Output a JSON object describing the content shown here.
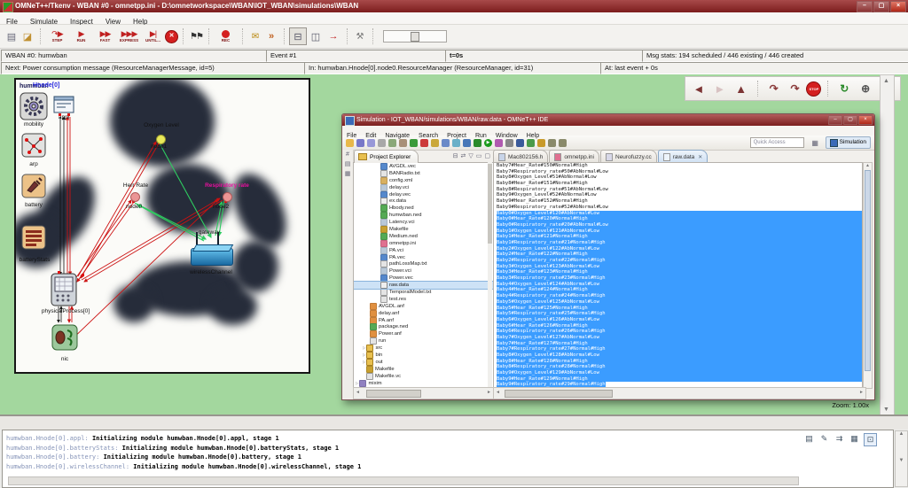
{
  "window": {
    "title": "OMNeT++/Tkenv - WBAN #0 - omnetpp.ini - D:\\omnetworkspace\\WBAN\\IOT_WBAN\\simulations\\WBAN",
    "menu": [
      "File",
      "Simulate",
      "Inspect",
      "View",
      "Help"
    ]
  },
  "toolbar": {
    "captions": {
      "step": "STEP",
      "run": "RUN",
      "fast": "FAST",
      "express": "EXPRESS",
      "until": "UNTIL...",
      "rec": "REC"
    },
    "icons": [
      "new-network",
      "load-config",
      "step",
      "run",
      "fast",
      "express",
      "until",
      "stop",
      "finish-flags",
      "record",
      "messages",
      "filter",
      "layout-horizontal",
      "layout-vertical",
      "timeline",
      "options-wrench",
      "speed-slider"
    ]
  },
  "status": {
    "network": "WBAN #0: humwban",
    "event": "Event #1",
    "sim_time": "t=0s",
    "msg_stats": "Msg stats: 194 scheduled / 446 existing / 446 created",
    "next_event": "Next: Power consumption message (ResourceManagerMessage, id=5)",
    "next_module": "In: humwban.Hnode[0].node0.ResourceManager (ResourceManager, id=31)",
    "next_time": "At: last event + 0s"
  },
  "canvas": {
    "network_label": "humwban",
    "node_label": "Hnode[0]",
    "zoom": "Zoom: 1.00x",
    "modules": {
      "appl": "appl",
      "mobility": "mobility",
      "arp": "arp",
      "battery": "battery",
      "battery_stats": "batteryStats",
      "physical_process": "physicalProcess[0]",
      "nic": "nic"
    },
    "sensors": {
      "oxygen": "Oxygen Level",
      "node1": "node1",
      "heart": "Herr Rate",
      "node0": "node0",
      "respiratory": "Respiratory rate",
      "node2": "node2",
      "gateway": "gateway",
      "wireless": "wirelessChannel"
    },
    "nav_icons": [
      "back",
      "forward",
      "up",
      "redo",
      "redo-until",
      "stop",
      "refresh",
      "zoom-in",
      "zoom-out"
    ]
  },
  "log": {
    "icons": [
      "copy",
      "pen",
      "filter",
      "fields",
      "monitor"
    ],
    "lines": [
      {
        "prefix": "humwban.Hnode[0].appl:",
        "text": "Initializing module humwban.Hnode[0].appl, stage 1"
      },
      {
        "prefix": "humwban.Hnode[0].batteryStats:",
        "text": "Initializing module humwban.Hnode[0].batteryStats, stage 1"
      },
      {
        "prefix": "humwban.Hnode[0].battery:",
        "text": "Initializing module humwban.Hnode[0].battery, stage 1"
      },
      {
        "prefix": "humwban.Hnode[0].wirelessChannel:",
        "text": "Initializing module humwban.Hnode[0].wirelessChannel, stage 1"
      }
    ]
  },
  "eclipse": {
    "title": "Simulation - IOT_WBAN/simulations/WBAN/raw.data - OMNeT++ IDE",
    "menu": [
      "File",
      "Edit",
      "Navigate",
      "Search",
      "Project",
      "Run",
      "Window",
      "Help"
    ],
    "quick_access": "Quick Access",
    "perspective": "Simulation",
    "toolbar_icons": [
      "new",
      "save",
      "save-all",
      "print",
      "import",
      "export",
      "run-last",
      "stop",
      "suspend",
      "step-into",
      "step-over",
      "search",
      "debug",
      "run",
      "profile",
      "external-tools",
      "open-type",
      "new-class",
      "sync",
      "nav-back",
      "nav-forward"
    ],
    "explorer": {
      "title": "Project Explorer",
      "items": [
        {
          "label": "AVGDL.vec",
          "icon": "vec",
          "indent": 30
        },
        {
          "label": "BANRadio.txt",
          "icon": "txt",
          "indent": 30
        },
        {
          "label": "config.xml",
          "icon": "xml",
          "indent": 30
        },
        {
          "label": "delay.vci",
          "icon": "vci",
          "indent": 30
        },
        {
          "label": "delay.vec",
          "icon": "vec",
          "indent": 30
        },
        {
          "label": "ex.data",
          "icon": "dat",
          "indent": 30
        },
        {
          "label": "Hbody.ned",
          "icon": "ned",
          "indent": 30
        },
        {
          "label": "humwban.ned",
          "icon": "ned",
          "indent": 30
        },
        {
          "label": "Latency.vci",
          "icon": "vci",
          "indent": 30
        },
        {
          "label": "Makefile",
          "icon": "mk",
          "indent": 30
        },
        {
          "label": "Medium.ned",
          "icon": "ned",
          "indent": 30
        },
        {
          "label": "omnetpp.ini",
          "icon": "ini",
          "indent": 30
        },
        {
          "label": "PA.vci",
          "icon": "vci",
          "indent": 30
        },
        {
          "label": "PA.vec",
          "icon": "vec",
          "indent": 30
        },
        {
          "label": "pathLossMap.txt",
          "icon": "txt",
          "indent": 30
        },
        {
          "label": "Power.vci",
          "icon": "vci",
          "indent": 30
        },
        {
          "label": "Power.vec",
          "icon": "vec",
          "indent": 30
        },
        {
          "label": "raw.data",
          "icon": "dat",
          "indent": 30,
          "selected": true
        },
        {
          "label": "TemporalModel.txt",
          "icon": "txt",
          "indent": 30
        },
        {
          "label": "test.res",
          "icon": "txt",
          "indent": 30
        },
        {
          "label": "AVGDL.anf",
          "icon": "anf",
          "indent": 18
        },
        {
          "label": "delay.anf",
          "icon": "anf",
          "indent": 18
        },
        {
          "label": "PA.anf",
          "icon": "anf",
          "indent": 18
        },
        {
          "label": "package.ned",
          "icon": "ned",
          "indent": 18
        },
        {
          "label": "Power.anf",
          "icon": "anf",
          "indent": 18
        },
        {
          "label": "run",
          "icon": "txt",
          "indent": 18
        },
        {
          "label": "src",
          "icon": "folder",
          "indent": 10,
          "arrow": true
        },
        {
          "label": "bin",
          "icon": "folder",
          "indent": 10,
          "arrow": true
        },
        {
          "label": "out",
          "icon": "folder",
          "indent": 10,
          "arrow": true
        },
        {
          "label": "Makefile",
          "icon": "mk",
          "indent": 14
        },
        {
          "label": "Makefile.vc",
          "icon": "txt",
          "indent": 14
        },
        {
          "label": "mixim",
          "icon": "proj",
          "indent": 2,
          "arrow": true
        }
      ]
    },
    "tabs": [
      {
        "label": "Mac802156.h",
        "icon": "h"
      },
      {
        "label": "omnetpp.ini",
        "icon": "ini"
      },
      {
        "label": "Neurofuzzy.cc",
        "icon": "cc"
      },
      {
        "label": "raw.data",
        "icon": "data",
        "active": true
      }
    ],
    "editor": {
      "selection_start": 8,
      "lines": [
        "Baby7#Hear_Rate#150#Normal#High",
        "Baby7#Respiratory_rate#50#AbNormal#Low",
        "Baby8#Oxygen_Level#51#AbNormal#Low",
        "Baby8#Hear_Rate#151#Normal#High",
        "Baby8#Respiratory_rate#51#AbNormal#Low",
        "Baby9#Oxygen_Level#52#AbNormal#Low",
        "Baby9#Hear_Rate#152#Normal#High",
        "Baby9#Respiratory_rate#52#AbNormal#Low",
        "Baby0#Oxygen_Level#120#AbNormal#Low",
        "Baby0#Hear_Rate#120#Normal#High",
        "Baby0#Respiratory_rate#20#AbNormal#Low",
        "Baby1#Oxygen_Level#121#AbNormal#Low",
        "Baby1#Hear_Rate#121#Normal#High",
        "Baby1#Respiratory_rate#21#Normal#High",
        "Baby2#Oxygen_Level#122#AbNormal#Low",
        "Baby2#Hear_Rate#122#Normal#High",
        "Baby2#Respiratory_rate#22#Normal#High",
        "Baby3#Oxygen_Level#123#AbNormal#Low",
        "Baby3#Hear_Rate#123#Normal#High",
        "Baby3#Respiratory_rate#23#Normal#High",
        "Baby4#Oxygen_Level#124#AbNormal#Low",
        "Baby4#Hear_Rate#124#Normal#High",
        "Baby4#Respiratory_rate#24#Normal#High",
        "Baby5#Oxygen_Level#125#AbNormal#Low",
        "Baby5#Hear_Rate#125#Normal#High",
        "Baby5#Respiratory_rate#25#Normal#High",
        "Baby6#Oxygen_Level#126#AbNormal#Low",
        "Baby6#Hear_Rate#126#Normal#High",
        "Baby6#Respiratory_rate#26#Normal#High",
        "Baby7#Oxygen_Level#127#AbNormal#Low",
        "Baby7#Hear_Rate#127#Normal#High",
        "Baby7#Respiratory_rate#27#Normal#High",
        "Baby8#Oxygen_Level#128#AbNormal#Low",
        "Baby8#Hear_Rate#128#Normal#High",
        "Baby8#Respiratory_rate#28#Normal#High",
        "Baby9#Oxygen_Level#129#AbNormal#Low",
        "Baby9#Hear_Rate#129#Normal#High",
        "Baby9#Respiratory_rate#29#Normal#High"
      ]
    }
  },
  "colors": {
    "title_bar": "#8f2424",
    "desktop": "#a3d79e",
    "selection": "#3b9cff",
    "respiratory_label": "#e8109e",
    "arrow_red": "#cc1111",
    "arrow_green": "#2ecc60"
  }
}
